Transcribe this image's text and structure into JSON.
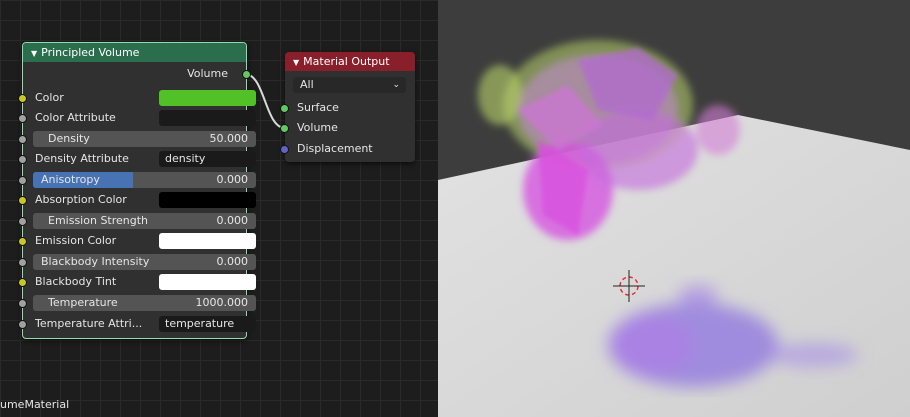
{
  "colors": {
    "principled_header": "#2b6e4e",
    "output_header": "#8a1f2c",
    "color_swatch": "#51c127",
    "absorption_swatch": "#000000",
    "emission_swatch": "#ffffff",
    "tint_swatch": "#ffffff",
    "slider_fill": "#4772b3"
  },
  "principled_node": {
    "title": "Principled Volume",
    "output_label": "Volume",
    "color_label": "Color",
    "color_attribute_label": "Color Attribute",
    "density_label": "Density",
    "density_value": "50.000",
    "density_attribute_label": "Density Attribute",
    "density_attribute_value": "density",
    "anisotropy_label": "Anisotropy",
    "anisotropy_value": "0.000",
    "absorption_color_label": "Absorption Color",
    "emission_strength_label": "Emission Strength",
    "emission_strength_value": "0.000",
    "emission_color_label": "Emission Color",
    "blackbody_intensity_label": "Blackbody Intensity",
    "blackbody_intensity_value": "0.000",
    "blackbody_tint_label": "Blackbody Tint",
    "temperature_label": "Temperature",
    "temperature_value": "1000.000",
    "temperature_attribute_label": "Temperature Attri...",
    "temperature_attribute_value": "temperature"
  },
  "output_node": {
    "title": "Material Output",
    "target_select": "All",
    "surface_label": "Surface",
    "volume_label": "Volume",
    "displacement_label": "Displacement"
  },
  "material_name": "umeMaterial",
  "viewport": {
    "objects": [
      "suzanne-volume",
      "ground-plane",
      "3d-cursor",
      "shadow"
    ]
  }
}
